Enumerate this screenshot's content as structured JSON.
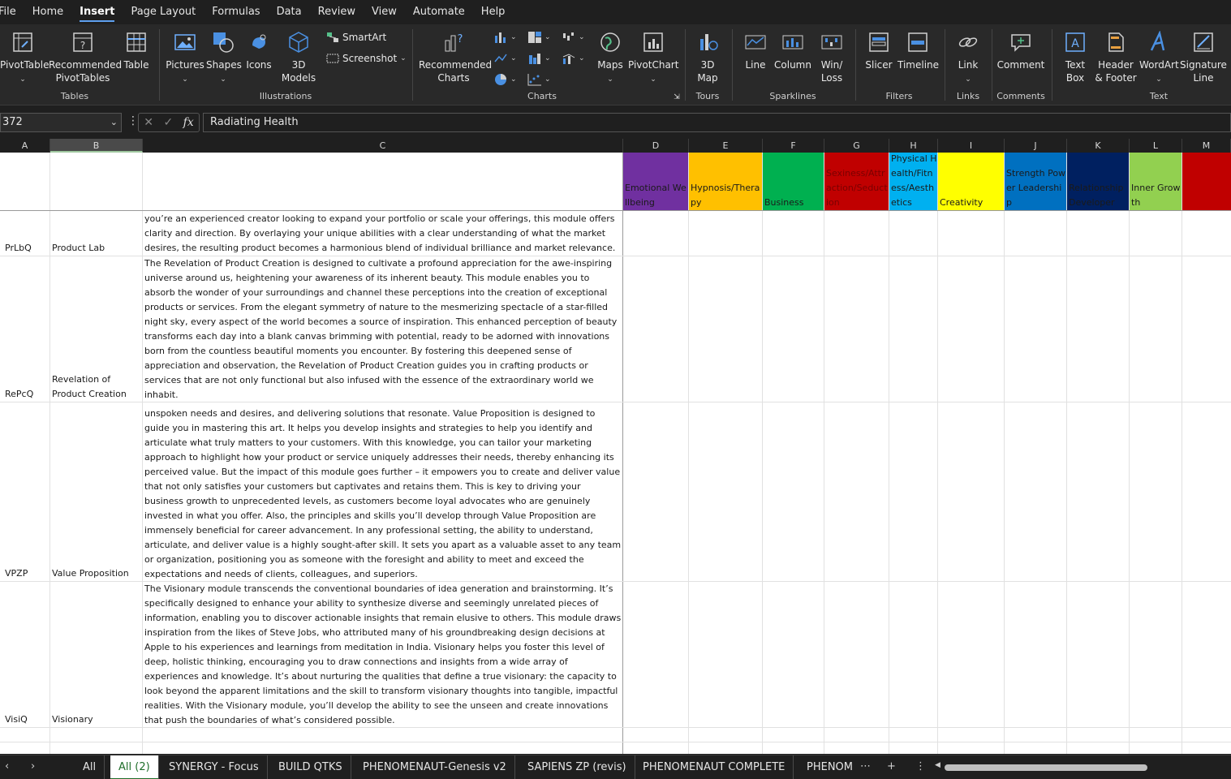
{
  "menu": [
    "File",
    "Home",
    "Insert",
    "Page Layout",
    "Formulas",
    "Data",
    "Review",
    "View",
    "Automate",
    "Help"
  ],
  "menu_active": "Insert",
  "ribbon": {
    "tables": {
      "group": "Tables",
      "pivottable": "PivotTable",
      "recommended_pivottables_1": "Recommended",
      "recommended_pivottables_2": "PivotTables",
      "table": "Table"
    },
    "illustrations": {
      "group": "Illustrations",
      "pictures": "Pictures",
      "shapes": "Shapes",
      "icons": "Icons",
      "models_1": "3D",
      "models_2": "Models",
      "smartart": "SmartArt",
      "screenshot": "Screenshot"
    },
    "charts": {
      "group": "Charts",
      "recommended_1": "Recommended",
      "recommended_2": "Charts",
      "maps": "Maps",
      "pivotchart": "PivotChart"
    },
    "tours": {
      "group": "Tours",
      "map_1": "3D",
      "map_2": "Map"
    },
    "sparklines": {
      "group": "Sparklines",
      "line": "Line",
      "column": "Column",
      "winloss_1": "Win/",
      "winloss_2": "Loss"
    },
    "filters": {
      "group": "Filters",
      "slicer": "Slicer",
      "timeline": "Timeline"
    },
    "links": {
      "group": "Links",
      "link": "Link"
    },
    "comments": {
      "group": "Comments",
      "comment": "Comment"
    },
    "text": {
      "group": "Text",
      "textbox_1": "Text",
      "textbox_2": "Box",
      "header_1": "Header",
      "header_2": "& Footer",
      "wordart": "WordArt",
      "signature_1": "Signature",
      "signature_2": "Line"
    }
  },
  "formula_bar": {
    "name_box": "372",
    "fx": "fx",
    "value": "Radiating Health"
  },
  "columns": [
    "A",
    "B",
    "C",
    "D",
    "E",
    "F",
    "G",
    "H",
    "I",
    "J",
    "K",
    "L",
    "M"
  ],
  "category_headers": [
    {
      "col": "D",
      "text": "Emotional Wellbeing",
      "color": "#7030a0"
    },
    {
      "col": "E",
      "text": "Hypnosis/Therapy",
      "color": "#ffc000"
    },
    {
      "col": "F",
      "text": "Business",
      "color": "#00b050"
    },
    {
      "col": "G",
      "text": "Sexiness/Attraction/Seduction",
      "color": "#c00000"
    },
    {
      "col": "H",
      "text": "Physical Health/Fitness/Aesthetics",
      "color": "#00b0f0"
    },
    {
      "col": "I",
      "text": "Creativity",
      "color": "#ffff00"
    },
    {
      "col": "J",
      "text": "Strength Power Leadership",
      "color": "#0070c0"
    },
    {
      "col": "K",
      "text": "Relationship Developer",
      "color": "#002060"
    },
    {
      "col": "L",
      "text": "Inner Growth",
      "color": "#92d050"
    },
    {
      "col": "M",
      "text": "",
      "color": "#c00000"
    }
  ],
  "rows": [
    {
      "code": "PrLbQ",
      "name": "Product Lab",
      "description": "you’re an experienced creator looking to expand your portfolio or scale your offerings, this module offers clarity and direction. By overlaying your unique abilities with a clear understanding of what the market desires, the resulting product becomes a harmonious blend of individual brilliance and market relevance."
    },
    {
      "code": "RePcQ",
      "name": "Revelation of Product Creation",
      "description": "The Revelation of Product Creation is designed to cultivate a profound appreciation for the awe-inspiring universe around us, heightening your awareness of its inherent beauty. This module enables you to absorb the wonder of your surroundings and channel these perceptions into the creation of exceptional products or services. From the elegant symmetry of nature to the mesmerizing spectacle of a star-filled night sky, every aspect of the world becomes a source of inspiration.   This enhanced perception of beauty transforms each day into a blank canvas brimming with potential, ready to be adorned with innovations born from the countless beautiful moments you encounter. By fostering this deepened sense of appreciation and observation, the Revelation of Product Creation guides you in crafting products or services that are not only functional but also infused with the essence of the extraordinary world we inhabit."
    },
    {
      "code": "VPZP",
      "name": "Value Proposition",
      "description": "unspoken needs and desires, and delivering solutions that resonate.  Value Proposition is designed to guide you in mastering this art. It helps you develop insights and strategies to help you identify and articulate what truly matters to your customers. With this knowledge, you can tailor your marketing approach to highlight how your product or service uniquely addresses their needs, thereby enhancing its perceived value. But the impact of this module goes further – it empowers you to create and deliver value that not only satisfies your customers but captivates and retains them. This is key to driving your business growth to unprecedented levels, as customers become loyal advocates who are genuinely invested in what you offer.  Also, the principles and skills you’ll develop through Value Proposition are immensely beneficial for career advancement. In any professional setting, the ability to understand, articulate, and deliver value is a highly sought-after skill. It sets you apart as a valuable asset to any team or organization, positioning you as someone with the foresight and ability to meet and exceed the expectations and needs of clients, colleagues, and superiors."
    },
    {
      "code": "VisiQ",
      "name": "Visionary",
      "description": "The Visionary module transcends the conventional boundaries of idea generation and brainstorming. It’s specifically designed to enhance your ability to synthesize diverse and seemingly unrelated pieces of information, enabling you to discover actionable insights that remain elusive to others. This module draws inspiration from the likes of Steve Jobs, who attributed many of his groundbreaking design decisions at Apple to his experiences and learnings from meditation in India.  Visionary helps you foster this level of deep, holistic thinking, encouraging you to draw connections and insights from a wide array of experiences and knowledge. It’s about nurturing the qualities that define a true visionary: the capacity to look beyond the apparent limitations and the skill to transform visionary thoughts into tangible, impactful realities. With the Visionary module, you’ll develop the ability to see the unseen and create innovations that push the boundaries of what’s considered possible."
    }
  ],
  "sheet_tabs": [
    "All",
    "All (2)",
    "SYNERGY - Focus",
    "BUILD QTKS",
    "PHENOMENAUT-Genesis v2",
    "SAPIENS ZP (revis)",
    "PHENOMENAUT COMPLETE",
    "PHENOM"
  ],
  "active_tab": "All (2)"
}
